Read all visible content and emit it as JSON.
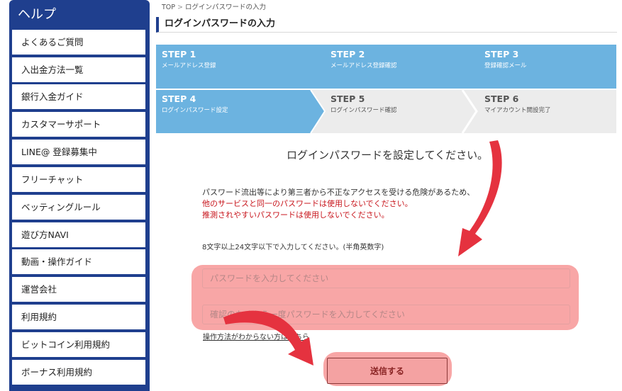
{
  "sidebar": {
    "title": "ヘルプ",
    "items": [
      {
        "label": "よくあるご質問"
      },
      {
        "label": "入出金方法一覧"
      },
      {
        "label": "銀行入金ガイド"
      },
      {
        "label": "カスタマーサポート"
      },
      {
        "label": "LINE@ 登録募集中"
      },
      {
        "label": "フリーチャット"
      },
      {
        "label": "ベッティングルール"
      },
      {
        "label": "遊び方NAVI"
      },
      {
        "label": "動画・操作ガイド"
      },
      {
        "label": "運営会社"
      },
      {
        "label": "利用規約"
      },
      {
        "label": "ビットコイン利用規約"
      },
      {
        "label": "ボーナス利用規約"
      }
    ]
  },
  "breadcrumb": {
    "home": "TOP",
    "separator": ">",
    "current": "ログインパスワードの入力"
  },
  "page_title": "ログインパスワードの入力",
  "steps": [
    {
      "num": "STEP 1",
      "label": "メールアドレス登録",
      "state": "done"
    },
    {
      "num": "STEP 2",
      "label": "メールアドレス登録確認",
      "state": "done"
    },
    {
      "num": "STEP 3",
      "label": "登録確認メール",
      "state": "done"
    },
    {
      "num": "STEP 4",
      "label": "ログインパスワード設定",
      "state": "current"
    },
    {
      "num": "STEP 5",
      "label": "ログインパスワード確認",
      "state": "todo"
    },
    {
      "num": "STEP 6",
      "label": "マイアカウント開設完了",
      "state": "todo"
    }
  ],
  "main": {
    "heading": "ログインパスワードを設定してください。",
    "notice_line1": "パスワード流出等により第三者から不正なアクセスを受ける危険があるため、",
    "notice_line2": "他のサービスと同一のパスワードは使用しないでください。",
    "notice_line3": "推測されやすいパスワードは使用しないでください。",
    "password_rule": "8文字以上24文字以下で入力してください。(半角英数字)",
    "password_placeholder": "パスワードを入力してください",
    "confirm_placeholder": "確認のためもう一度パスワードを入力してください",
    "help_link": "操作方法がわからない方はこちら",
    "submit_label": "送信する"
  },
  "colors": {
    "sidebar": "#1f3f8e",
    "step_active": "#6cb3e0",
    "step_inactive": "#ececec",
    "warning_text": "#c8161d",
    "annotation_arrow": "#e5323f",
    "highlight": "#f47676"
  }
}
